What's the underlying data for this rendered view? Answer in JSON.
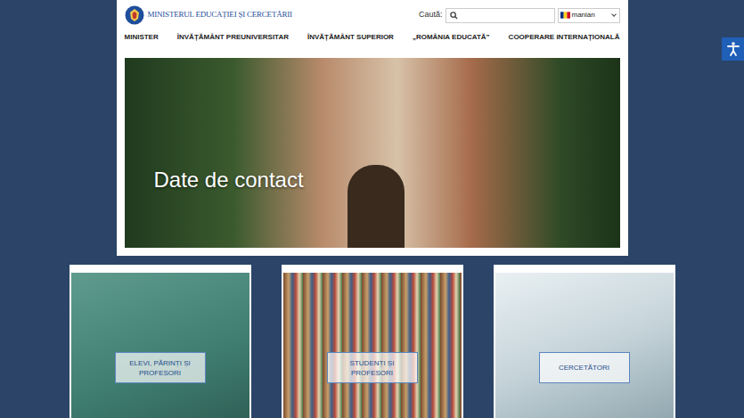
{
  "logo": {
    "text": "MINISTERUL EDUCAȚIEI ȘI CERCETĂRII"
  },
  "search": {
    "label": "Caută:"
  },
  "language": {
    "value": "manian"
  },
  "nav": [
    {
      "label": "MINISTER"
    },
    {
      "label": "ÎNVĂȚĂMÂNT PREUNIVERSITAR"
    },
    {
      "label": "ÎNVĂȚĂMÂNT SUPERIOR"
    },
    {
      "label": "„ROMÂNIA EDUCATĂ”"
    },
    {
      "label": "COOPERARE INTERNAȚIONALĂ"
    }
  ],
  "hero": {
    "title": "Date de contact"
  },
  "cards": [
    {
      "label": "ELEVI, PĂRINȚI ȘI PROFESORI"
    },
    {
      "label": "STUDENȚI ȘI PROFESORI"
    },
    {
      "label": "CERCETĂTORI"
    }
  ]
}
